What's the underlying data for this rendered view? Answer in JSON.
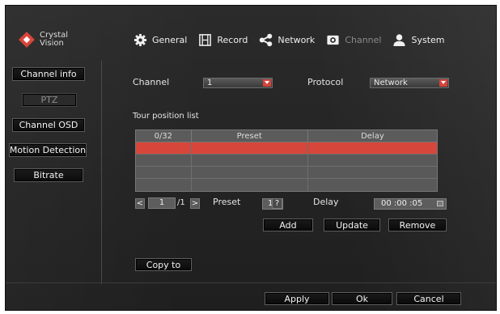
{
  "brand": {
    "line1": "Crystal",
    "line2": "Vision",
    "accent": "#d9453a"
  },
  "nav": [
    {
      "label": "General",
      "icon": "gear-icon"
    },
    {
      "label": "Record",
      "icon": "film-icon"
    },
    {
      "label": "Network",
      "icon": "share-icon"
    },
    {
      "label": "Channel",
      "icon": "camera-icon",
      "active": true
    },
    {
      "label": "System",
      "icon": "user-icon"
    }
  ],
  "sidebar": [
    {
      "label": "Channel info"
    },
    {
      "label": "PTZ",
      "active": true
    },
    {
      "label": "Channel OSD"
    },
    {
      "label": "Motion Detection"
    },
    {
      "label": "Bitrate"
    }
  ],
  "channel": {
    "label": "Channel",
    "value": "1"
  },
  "protocol": {
    "label": "Protocol",
    "value": "Network"
  },
  "tour": {
    "title": "Tour position list",
    "headers": [
      "0/32",
      "Preset",
      "Delay"
    ]
  },
  "pager": {
    "prev": "<",
    "page": "1",
    "total": "/1",
    "next": ">"
  },
  "preset": {
    "label": "Preset",
    "value": "1",
    "help": "?"
  },
  "delay": {
    "label": "Delay",
    "value": "00 :00 :05"
  },
  "actions": {
    "add": "Add",
    "update": "Update",
    "remove": "Remove",
    "copy_to": "Copy to"
  },
  "footer": {
    "apply": "Apply",
    "ok": "Ok",
    "cancel": "Cancel"
  }
}
